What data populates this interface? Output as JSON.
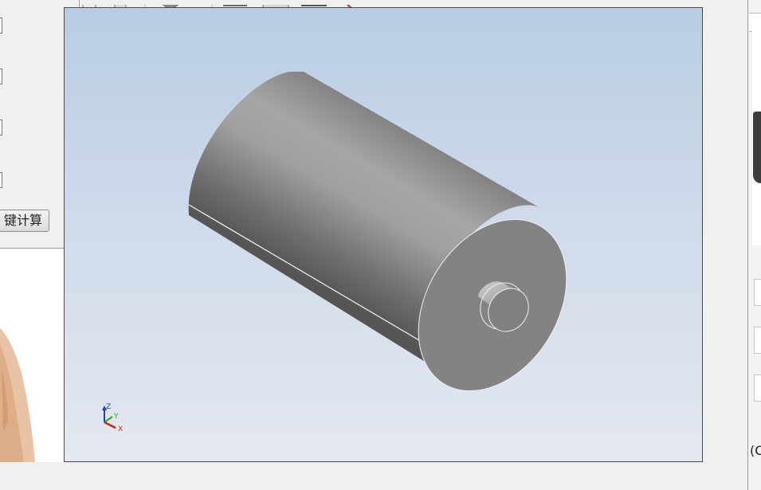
{
  "left_panel": {
    "calc_button_label": "键计算"
  },
  "viewport": {
    "model": "cylinder-with-shaft",
    "axis_triad": {
      "z_label": "Z",
      "y_label": "Y",
      "x_label": "X"
    },
    "background_top_color": "#b8cde4",
    "background_bottom_color": "#e4e8f0"
  },
  "right_window": {
    "partial_text": "(C"
  }
}
